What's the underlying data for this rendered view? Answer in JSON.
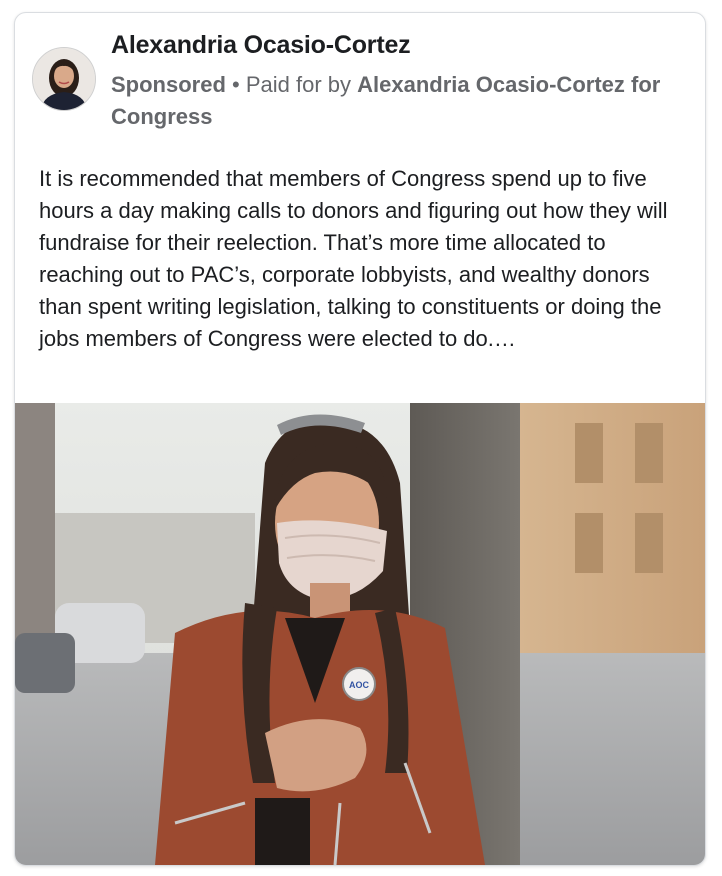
{
  "post": {
    "page_name": "Alexandria Ocasio-Cortez",
    "sponsored_label": "Sponsored",
    "separator": " • ",
    "paid_for_prefix": "Paid for by ",
    "paid_for_by": "Alexandria Ocasio-Cortez for Congress",
    "body_text": "It is recommended that members of Congress spend up to five hours a day making calls to donors and figuring out how they will fundraise for their reelection. That’s more time allocated to reaching out to PAC’s, corporate lobbyists, and wealthy donors than spent writing legislation, talking to constituents or doing the jobs members of Congress were elected to do.…"
  },
  "icons": {
    "avatar": "profile-photo",
    "photo": "woman-in-mask-photo"
  },
  "colors": {
    "name_text": "#1c1e21",
    "secondary_text": "#65676b",
    "card_border": "#dadde1",
    "jacket": "#9c4a30"
  }
}
